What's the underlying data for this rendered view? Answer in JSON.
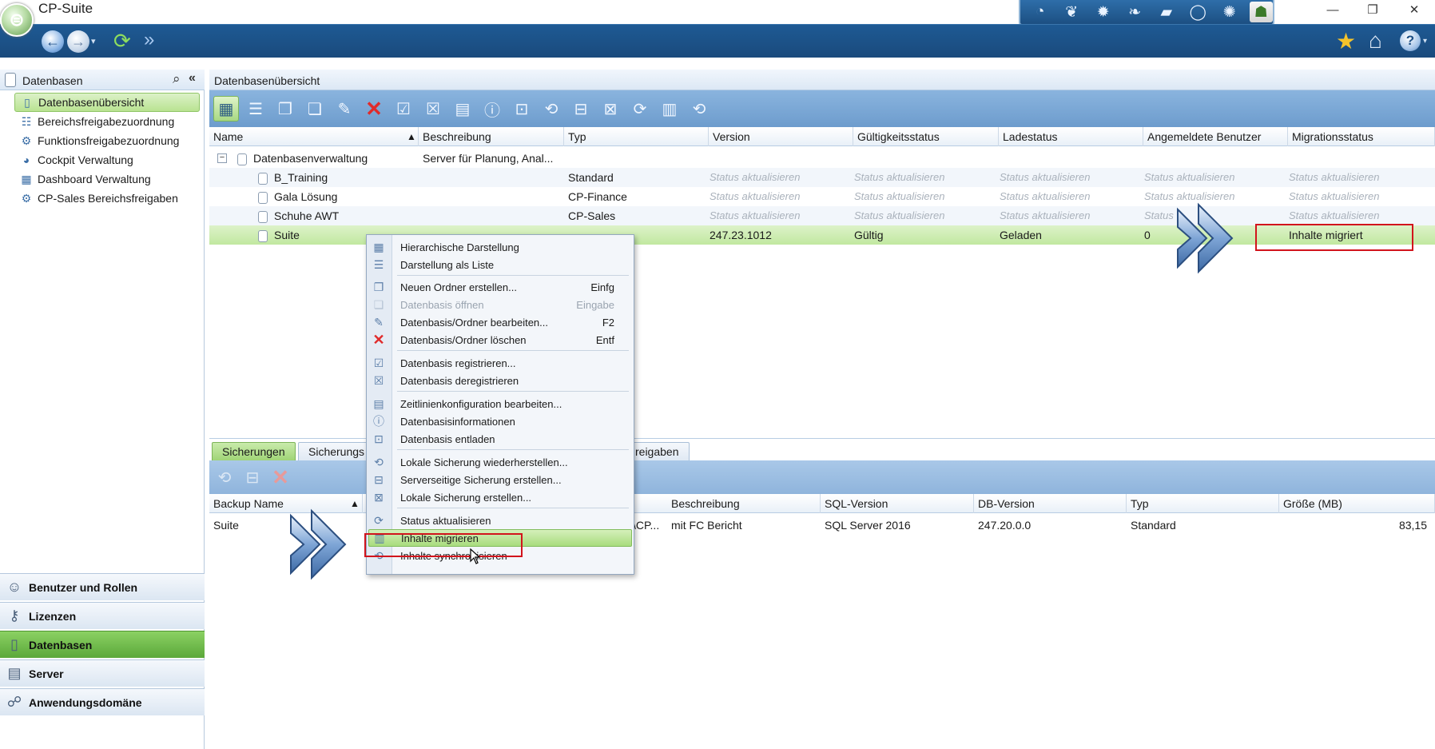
{
  "window": {
    "title": "CP-Suite",
    "minimize": "—",
    "restore": "❐",
    "close": "✕"
  },
  "nav": {
    "back": "←",
    "forward": "→",
    "dropdown": "▾",
    "refresh": "⟳",
    "jump": "»",
    "favorites": "★",
    "home": "⌂",
    "help": "?",
    "help_dropdown": "▾"
  },
  "toolstrip": [
    "◔",
    "❦",
    "✹",
    "❧",
    "▰",
    "◯",
    "✺",
    "☗"
  ],
  "left_panel": {
    "title": "Datenbasen",
    "search_icon": "⌕",
    "collapse_icon": "«",
    "tree": [
      {
        "label": "Datenbasenübersicht",
        "icon": "▯",
        "selected": true
      },
      {
        "label": "Bereichsfreigabezuordnung",
        "icon": "☷"
      },
      {
        "label": "Funktionsfreigabezuordnung",
        "icon": "⚙"
      },
      {
        "label": "Cockpit Verwaltung",
        "icon": "◕"
      },
      {
        "label": "Dashboard Verwaltung",
        "icon": "▦"
      },
      {
        "label": "CP-Sales Bereichsfreigaben",
        "icon": "⚙"
      }
    ],
    "sections": [
      {
        "label": "Benutzer und Rollen",
        "icon": "☺"
      },
      {
        "label": "Lizenzen",
        "icon": "⚷"
      },
      {
        "label": "Datenbasen",
        "icon": "▯",
        "active": true
      },
      {
        "label": "Server",
        "icon": "▤"
      },
      {
        "label": "Anwendungsdomäne",
        "icon": "☍"
      }
    ]
  },
  "main": {
    "title": "Datenbasenübersicht",
    "toolbar": [
      "▦",
      "☰",
      "❐",
      "❏",
      "✎",
      "✕",
      "☑",
      "☒",
      "▤",
      "ⓘ",
      "⊡",
      "⟲",
      "⊟",
      "⊠",
      "⟳",
      "▥",
      "⟲"
    ],
    "columns": [
      "Name",
      "Beschreibung",
      "Typ",
      "Version",
      "Gültigkeitsstatus",
      "Ladestatus",
      "Angemeldete Benutzer",
      "Migrationsstatus"
    ],
    "sort_arrow": "▲",
    "expander": "−",
    "rows": [
      {
        "name": "Datenbasenverwaltung",
        "description": "Server für Planung, Anal...",
        "type": "",
        "version": "",
        "validity": "",
        "load": "",
        "users": "",
        "migration": ""
      },
      {
        "name": "B_Training",
        "description": "",
        "type": "Standard",
        "version": "Status aktualisieren",
        "validity": "Status aktualisieren",
        "load": "Status aktualisieren",
        "users": "Status aktualisieren",
        "migration": "Status aktualisieren"
      },
      {
        "name": "Gala Lösung",
        "description": "",
        "type": "CP-Finance",
        "version": "Status aktualisieren",
        "validity": "Status aktualisieren",
        "load": "Status aktualisieren",
        "users": "Status aktualisieren",
        "migration": "Status aktualisieren"
      },
      {
        "name": "Schuhe AWT",
        "description": "",
        "type": "CP-Sales",
        "version": "Status aktualisieren",
        "validity": "Status aktualisieren",
        "load": "Status aktualisieren",
        "users": "Status",
        "migration": "Status aktualisieren"
      },
      {
        "name": "Suite",
        "description": "",
        "type": "",
        "version": "247.23.1012",
        "validity": "Gültig",
        "load": "Geladen",
        "users": "0",
        "migration": "Inhalte migriert"
      }
    ]
  },
  "lower": {
    "tabs": [
      "Sicherungen",
      "Sicherungs",
      "reigaben"
    ],
    "toolbar": [
      "⟲",
      "⊟",
      "✕"
    ],
    "columns": [
      "Backup Name",
      "Beschreibung",
      "SQL-Version",
      "DB-Version",
      "Typ",
      "Größe (MB)"
    ],
    "sort_arrow": "▲",
    "rows": [
      {
        "name": "Suite",
        "path_fragment": "\\CP...",
        "description": "mit FC Bericht",
        "sql_version": "SQL Server 2016",
        "db_version": "247.20.0.0",
        "type": "Standard",
        "size": "83,15"
      }
    ]
  },
  "context_menu": {
    "items": [
      {
        "label": "Hierarchische Darstellung",
        "icon": "▦",
        "shortcut": ""
      },
      {
        "label": "Darstellung als Liste",
        "icon": "☰",
        "shortcut": ""
      },
      {
        "label": "Neuen Ordner erstellen...",
        "icon": "❐",
        "shortcut": "Einfg"
      },
      {
        "label": "Datenbasis öffnen",
        "icon": "❏",
        "shortcut": "Eingabe",
        "disabled": true
      },
      {
        "label": "Datenbasis/Ordner bearbeiten...",
        "icon": "✎",
        "shortcut": "F2"
      },
      {
        "label": "Datenbasis/Ordner löschen",
        "icon": "✕",
        "shortcut": "Entf",
        "danger": true
      },
      {
        "label": "Datenbasis registrieren...",
        "icon": "☑",
        "shortcut": ""
      },
      {
        "label": "Datenbasis deregistrieren",
        "icon": "☒",
        "shortcut": ""
      },
      {
        "label": "Zeitlinienkonfiguration bearbeiten...",
        "icon": "▤",
        "shortcut": ""
      },
      {
        "label": "Datenbasisinformationen",
        "icon": "ⓘ",
        "shortcut": ""
      },
      {
        "label": "Datenbasis entladen",
        "icon": "⊡",
        "shortcut": ""
      },
      {
        "label": "Lokale Sicherung wiederherstellen...",
        "icon": "⟲",
        "shortcut": ""
      },
      {
        "label": "Serverseitige Sicherung erstellen...",
        "icon": "⊟",
        "shortcut": ""
      },
      {
        "label": "Lokale Sicherung erstellen...",
        "icon": "⊠",
        "shortcut": ""
      },
      {
        "label": "Status aktualisieren",
        "icon": "⟳",
        "shortcut": ""
      },
      {
        "label": "Inhalte migrieren",
        "icon": "▥",
        "shortcut": "",
        "highlighted": true
      },
      {
        "label": "Inhalte synchronisieren",
        "icon": "⟲",
        "shortcut": ""
      }
    ]
  },
  "colors": {
    "nav_blue": "#1e5a94",
    "selection_green": "#b9e391",
    "annotation_red": "#d2141c",
    "toolbar_blue": "#7aa8d6"
  }
}
